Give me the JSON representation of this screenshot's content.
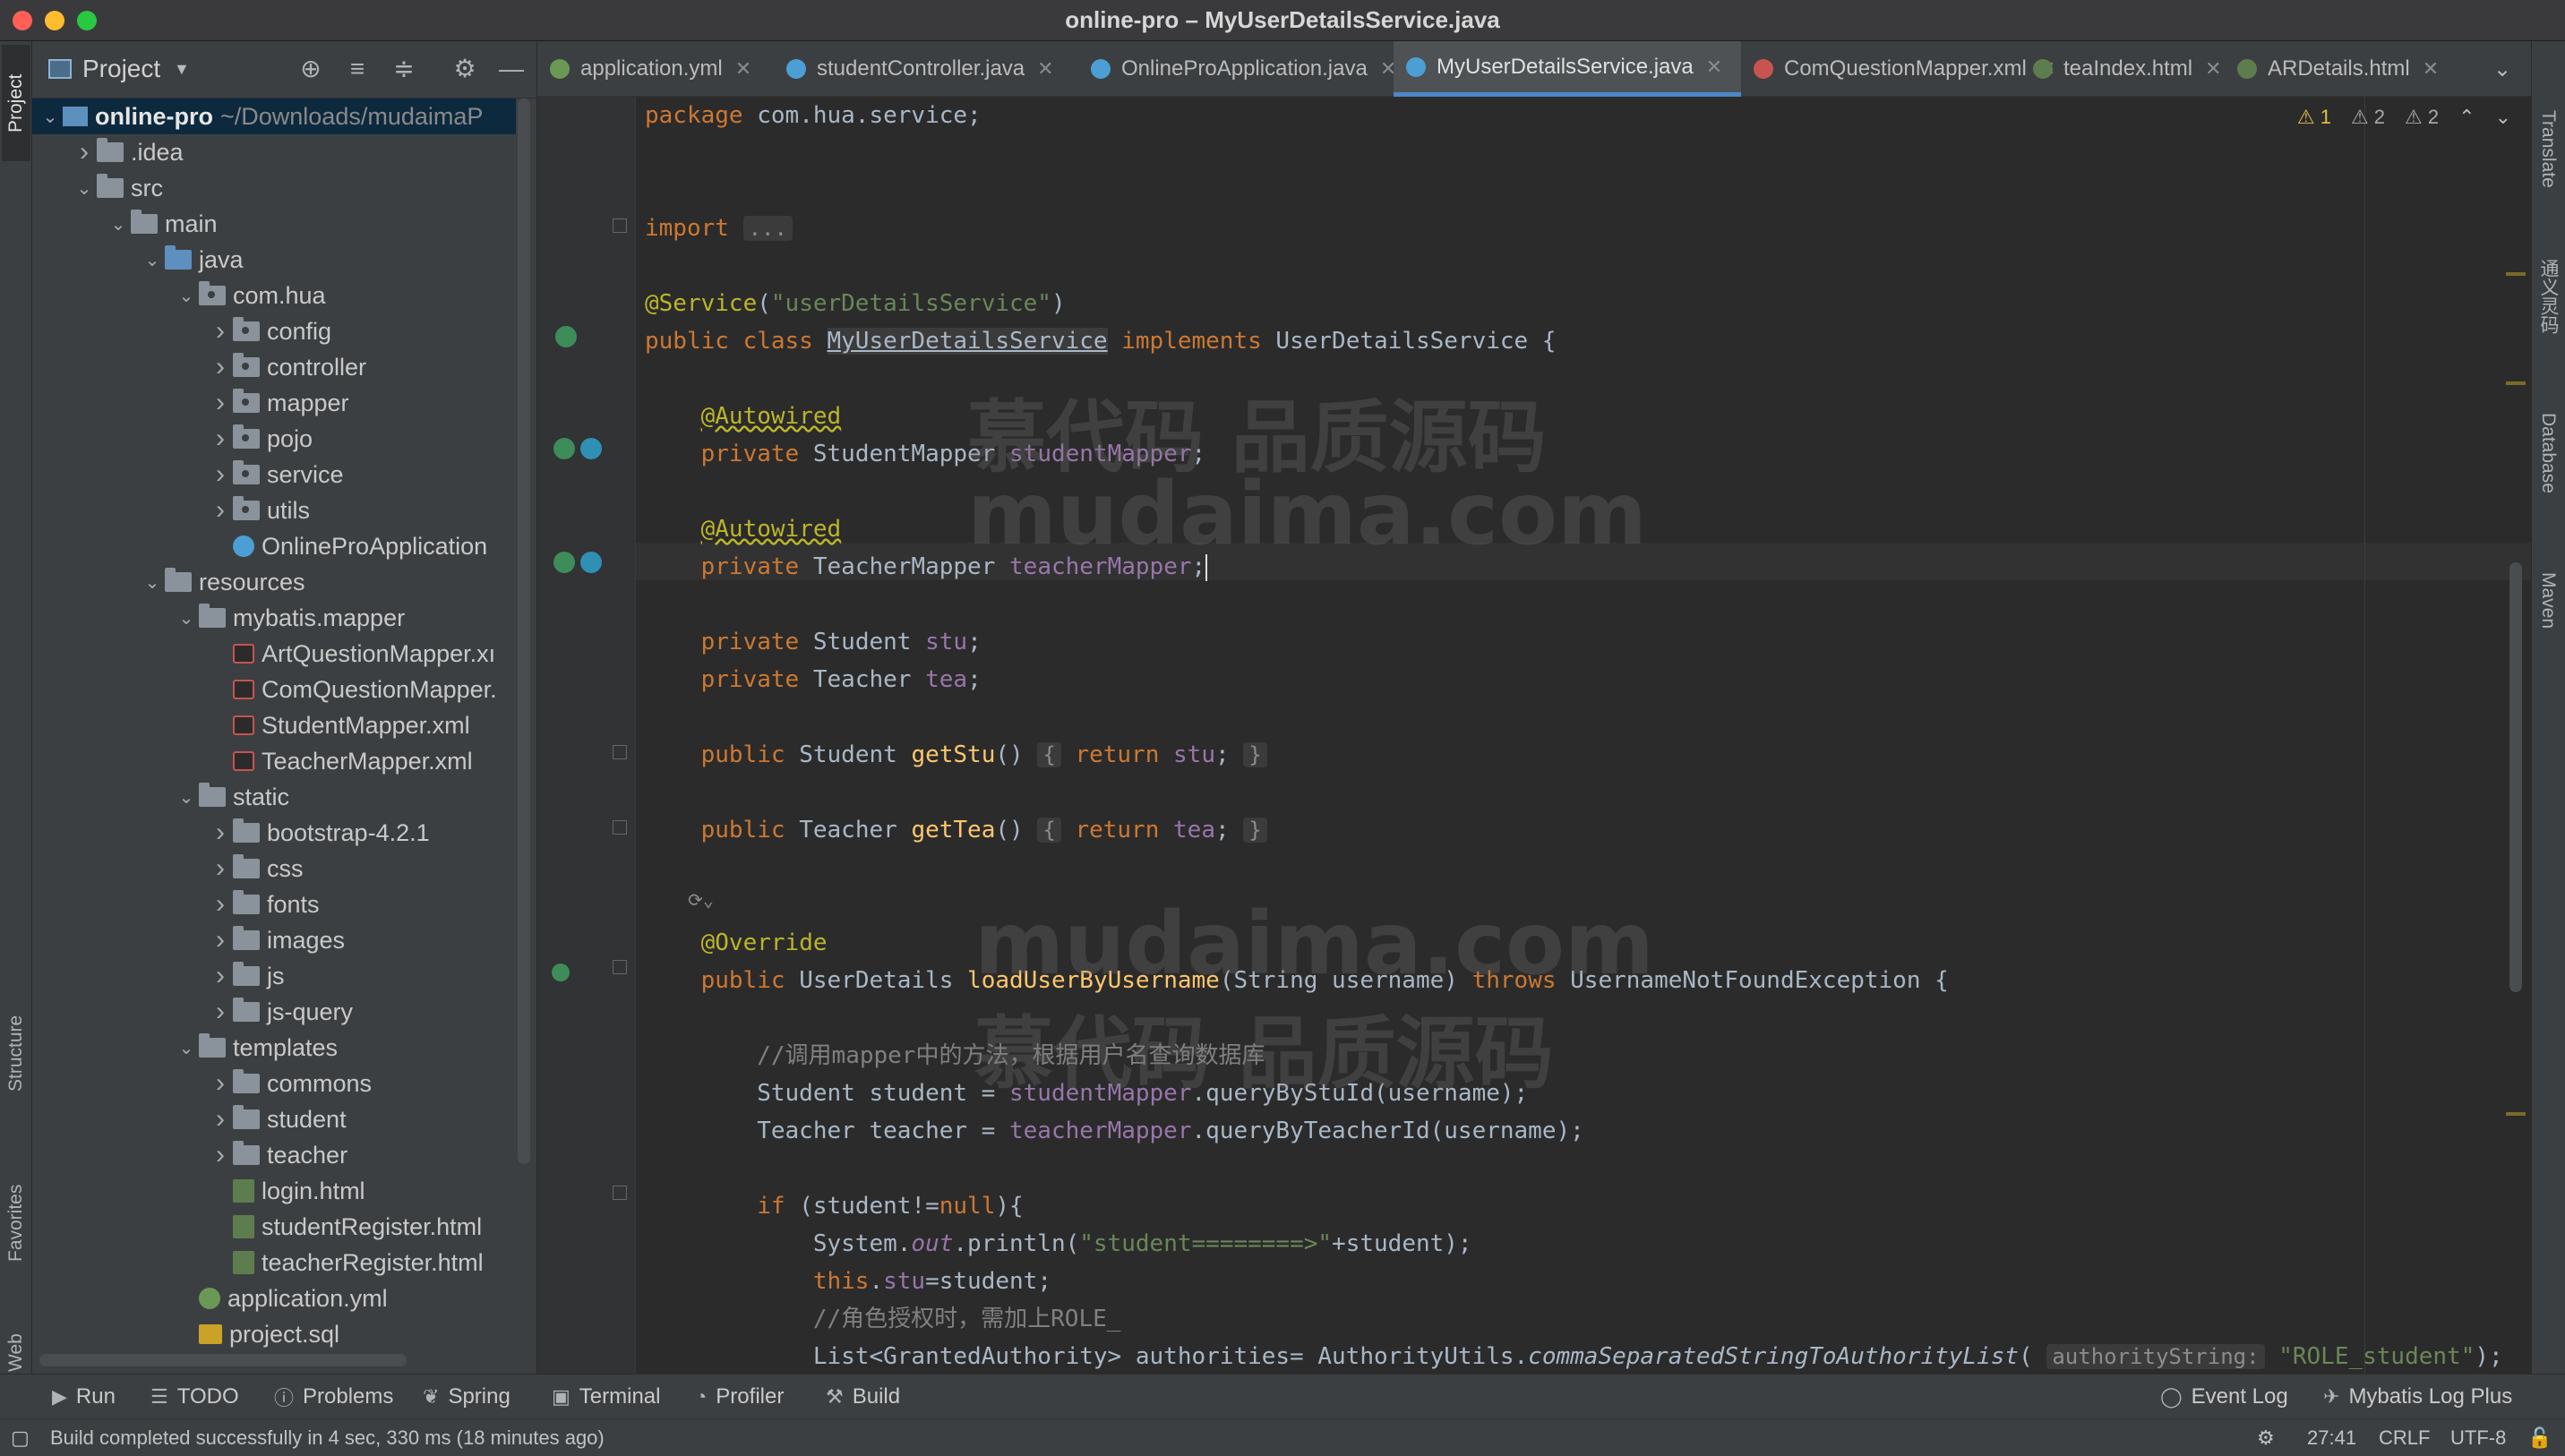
{
  "window": {
    "title": "online-pro – MyUserDetailsService.java"
  },
  "left_stripe": {
    "project": "Project",
    "structure": "Structure",
    "favorites": "Favorites",
    "web": "Web"
  },
  "right_stripe": {
    "translate": "Translate",
    "tongyi": "通义灵码",
    "database": "Database",
    "maven": "Maven"
  },
  "project_panel": {
    "title": "Project",
    "tree": [
      {
        "label": "online-pro",
        "extra": "~/Downloads/mudaimaP",
        "type": "module",
        "depth": 0,
        "arrow": "v",
        "selected": true
      },
      {
        "label": ".idea",
        "type": "folder",
        "depth": 1,
        "arrow": ">"
      },
      {
        "label": "src",
        "type": "folder",
        "depth": 1,
        "arrow": "v"
      },
      {
        "label": "main",
        "type": "folder",
        "depth": 2,
        "arrow": "v"
      },
      {
        "label": "java",
        "type": "folder-blue",
        "depth": 3,
        "arrow": "v"
      },
      {
        "label": "com.hua",
        "type": "package",
        "depth": 4,
        "arrow": "v"
      },
      {
        "label": "config",
        "type": "package",
        "depth": 5,
        "arrow": ">"
      },
      {
        "label": "controller",
        "type": "package",
        "depth": 5,
        "arrow": ">"
      },
      {
        "label": "mapper",
        "type": "package",
        "depth": 5,
        "arrow": ">"
      },
      {
        "label": "pojo",
        "type": "package",
        "depth": 5,
        "arrow": ">"
      },
      {
        "label": "service",
        "type": "package",
        "depth": 5,
        "arrow": ">"
      },
      {
        "label": "utils",
        "type": "package",
        "depth": 5,
        "arrow": ">"
      },
      {
        "label": "OnlineProApplication",
        "type": "class",
        "depth": 5,
        "arrow": ""
      },
      {
        "label": "resources",
        "type": "folder",
        "depth": 3,
        "arrow": "v"
      },
      {
        "label": "mybatis.mapper",
        "type": "folder",
        "depth": 4,
        "arrow": "v"
      },
      {
        "label": "ArtQuestionMapper.xı",
        "type": "xml",
        "depth": 5,
        "arrow": ""
      },
      {
        "label": "ComQuestionMapper.",
        "type": "xml",
        "depth": 5,
        "arrow": ""
      },
      {
        "label": "StudentMapper.xml",
        "type": "xml",
        "depth": 5,
        "arrow": ""
      },
      {
        "label": "TeacherMapper.xml",
        "type": "xml",
        "depth": 5,
        "arrow": ""
      },
      {
        "label": "static",
        "type": "folder",
        "depth": 4,
        "arrow": "v"
      },
      {
        "label": "bootstrap-4.2.1",
        "type": "folder",
        "depth": 5,
        "arrow": ">"
      },
      {
        "label": "css",
        "type": "folder",
        "depth": 5,
        "arrow": ">"
      },
      {
        "label": "fonts",
        "type": "folder",
        "depth": 5,
        "arrow": ">"
      },
      {
        "label": "images",
        "type": "folder",
        "depth": 5,
        "arrow": ">"
      },
      {
        "label": "js",
        "type": "folder",
        "depth": 5,
        "arrow": ">"
      },
      {
        "label": "js-query",
        "type": "folder",
        "depth": 5,
        "arrow": ">"
      },
      {
        "label": "templates",
        "type": "folder",
        "depth": 4,
        "arrow": "v"
      },
      {
        "label": "commons",
        "type": "folder",
        "depth": 5,
        "arrow": ">"
      },
      {
        "label": "student",
        "type": "folder",
        "depth": 5,
        "arrow": ">"
      },
      {
        "label": "teacher",
        "type": "folder",
        "depth": 5,
        "arrow": ">"
      },
      {
        "label": "login.html",
        "type": "html",
        "depth": 5,
        "arrow": ""
      },
      {
        "label": "studentRegister.html",
        "type": "html",
        "depth": 5,
        "arrow": ""
      },
      {
        "label": "teacherRegister.html",
        "type": "html",
        "depth": 5,
        "arrow": ""
      },
      {
        "label": "application.yml",
        "type": "yml",
        "depth": 4,
        "arrow": ""
      },
      {
        "label": "project.sql",
        "type": "sql",
        "depth": 4,
        "arrow": ""
      }
    ]
  },
  "tabs": [
    {
      "label": "application.yml",
      "icon_color": "#6a9955",
      "active": false
    },
    {
      "label": "studentController.java",
      "icon_color": "#4b9fd5",
      "active": false
    },
    {
      "label": "OnlineProApplication.java",
      "icon_color": "#4b9fd5",
      "active": false
    },
    {
      "label": "MyUserDetailsService.java",
      "icon_color": "#4b9fd5",
      "active": true
    },
    {
      "label": "ComQuestionMapper.xml",
      "icon_color": "#c75450",
      "active": false
    },
    {
      "label": "teaIndex.html",
      "icon_color": "#5e7d4e",
      "active": false
    },
    {
      "label": "ARDetails.html",
      "icon_color": "#5e7d4e",
      "active": false
    }
  ],
  "editor": {
    "inspection": {
      "errors": "1",
      "warnings": "2",
      "weak": "2"
    },
    "watermark_cn": "慕代码 品质源码",
    "watermark_en": "mudaima.com"
  },
  "bottom_tools": {
    "run": "Run",
    "todo": "TODO",
    "problems": "Problems",
    "spring": "Spring",
    "terminal": "Terminal",
    "profiler": "Profiler",
    "build": "Build",
    "event_log": "Event Log",
    "mybatis": "Mybatis Log Plus"
  },
  "status": {
    "message": "Build completed successfully in 4 sec, 330 ms (18 minutes ago)",
    "position": "27:41",
    "line_sep": "CRLF",
    "encoding": "UTF-8"
  }
}
